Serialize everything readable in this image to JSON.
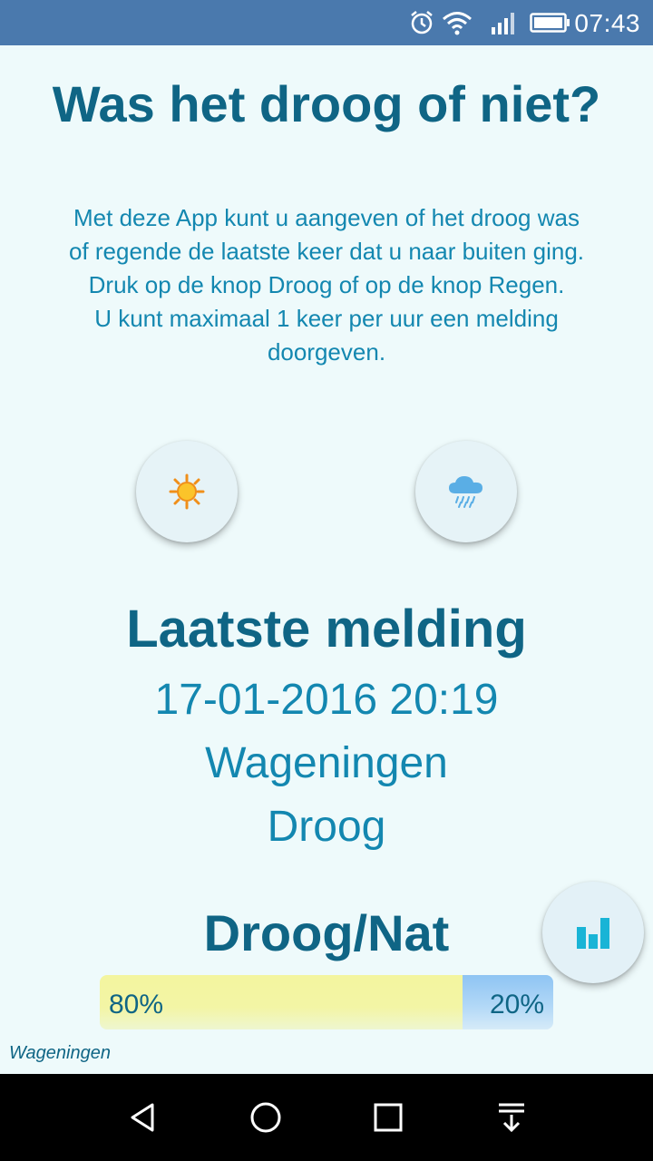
{
  "status_bar": {
    "time": "07:43",
    "icons": [
      "alarm-icon",
      "wifi-icon",
      "signal-icon",
      "battery-icon"
    ]
  },
  "main": {
    "title": "Was het droog of niet?",
    "intro_lines": [
      "Met deze App kunt u aangeven of het droog was",
      "of regende de laatste keer dat u naar buiten ging.",
      "Druk op de knop Droog of op de knop Regen.",
      "U kunt maximaal 1 keer per uur een melding",
      "doorgeven."
    ],
    "buttons": {
      "dry_icon": "sun-icon",
      "rain_icon": "rain-cloud-icon",
      "stats_icon": "bar-chart-icon"
    },
    "last_report": {
      "heading": "Laatste melding",
      "datetime": "17-01-2016 20:19",
      "place": "Wageningen",
      "status": "Droog"
    },
    "ratio": {
      "heading": "Droog/Nat",
      "dry_fraction": 0.8,
      "dry_label": "80%",
      "wet_label": "20%"
    },
    "footer_place": "Wageningen"
  },
  "colors": {
    "background": "#eefafb",
    "status_bar": "#4a79ad",
    "heading": "#0f6585",
    "text": "#1387b0",
    "sun": "#f6a81a",
    "rain": "#4fa8e0",
    "stats": "#19b4d6"
  },
  "nav_bar": {
    "icons": [
      "back-icon",
      "home-icon",
      "recent-apps-icon",
      "notification-drawer-icon"
    ]
  }
}
